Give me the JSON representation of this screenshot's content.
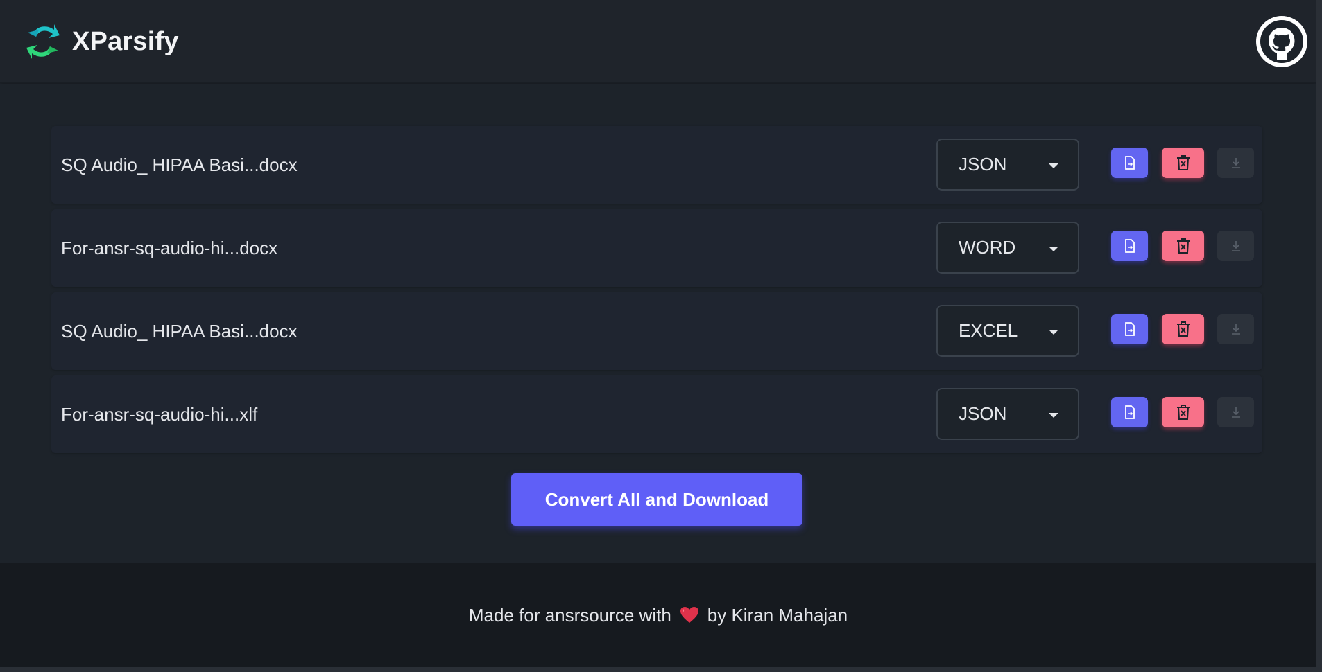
{
  "header": {
    "app_name": "XParsify"
  },
  "files": [
    {
      "name": "SQ Audio_ HIPAA Basi...docx",
      "format": "JSON"
    },
    {
      "name": "For-ansr-sq-audio-hi...docx",
      "format": "WORD"
    },
    {
      "name": "SQ Audio_ HIPAA Basi...docx",
      "format": "EXCEL"
    },
    {
      "name": "For-ansr-sq-audio-hi...xlf",
      "format": "JSON"
    }
  ],
  "actions": {
    "convert_all_label": "Convert All and Download"
  },
  "footer": {
    "made_for_text": "Made for ansrsource with",
    "by_text": "by Kiran Mahajan"
  },
  "colors": {
    "accent": "#6366f1",
    "danger": "#f87189",
    "background": "#1d232a",
    "footer_bg": "#161a1f"
  },
  "icons": {
    "convert": "file-convert-icon",
    "delete": "trash-icon",
    "download": "download-icon",
    "github": "github-icon",
    "heart": "heart-icon",
    "logo": "xparsify-logo"
  }
}
